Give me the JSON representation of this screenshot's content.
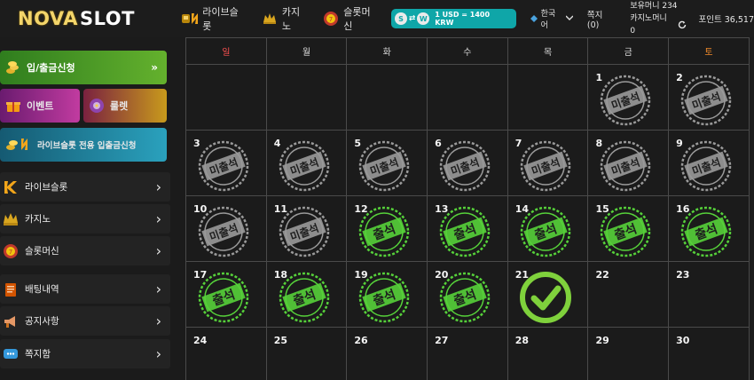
{
  "brand": {
    "logo_part1": "NOVA",
    "logo_part2": "SLOT"
  },
  "topnav": {
    "items": [
      {
        "label": "라이브슬롯",
        "icon": "live-slot-icon"
      },
      {
        "label": "카지노",
        "icon": "casino-icon"
      },
      {
        "label": "슬롯머신",
        "icon": "slot-machine-icon"
      }
    ],
    "rate_badge": {
      "coin1": "S",
      "coin2": "W",
      "text": "1 USD = 1400 KRW"
    },
    "language": "한국어",
    "message": "쪽지(0)",
    "holding_money": "보유머니 234",
    "casino_money": "카지노머니 0",
    "points": "포인트 36,517"
  },
  "sidebar": {
    "deposit": "입/출금신청",
    "event": "이벤트",
    "roulette": "룰렛",
    "live_deposit": "라이브슬롯 전용 입출금신청",
    "menu": [
      {
        "label": "라이브슬롯",
        "icon": "live-slot-icon"
      },
      {
        "label": "카지노",
        "icon": "casino-icon"
      },
      {
        "label": "슬롯머신",
        "icon": "slot-machine-icon"
      },
      {
        "label": "배팅내역",
        "icon": "betting-history-icon"
      },
      {
        "label": "공지사항",
        "icon": "megaphone-icon"
      },
      {
        "label": "쪽지함",
        "icon": "message-box-icon"
      }
    ]
  },
  "calendar": {
    "weekdays": [
      "일",
      "월",
      "화",
      "수",
      "목",
      "금",
      "토"
    ],
    "absent_label": "미출석",
    "present_label": "출석",
    "days": [
      {
        "day": "",
        "status": ""
      },
      {
        "day": "",
        "status": ""
      },
      {
        "day": "",
        "status": ""
      },
      {
        "day": "",
        "status": ""
      },
      {
        "day": "",
        "status": ""
      },
      {
        "day": "1",
        "status": "absent"
      },
      {
        "day": "2",
        "status": "absent"
      },
      {
        "day": "3",
        "status": "absent"
      },
      {
        "day": "4",
        "status": "absent"
      },
      {
        "day": "5",
        "status": "absent"
      },
      {
        "day": "6",
        "status": "absent"
      },
      {
        "day": "7",
        "status": "absent"
      },
      {
        "day": "8",
        "status": "absent"
      },
      {
        "day": "9",
        "status": "absent"
      },
      {
        "day": "10",
        "status": "absent"
      },
      {
        "day": "11",
        "status": "absent"
      },
      {
        "day": "12",
        "status": "present"
      },
      {
        "day": "13",
        "status": "present"
      },
      {
        "day": "14",
        "status": "present"
      },
      {
        "day": "15",
        "status": "present"
      },
      {
        "day": "16",
        "status": "present"
      },
      {
        "day": "17",
        "status": "present"
      },
      {
        "day": "18",
        "status": "present"
      },
      {
        "day": "19",
        "status": "present"
      },
      {
        "day": "20",
        "status": "present"
      },
      {
        "day": "21",
        "status": "today"
      },
      {
        "day": "22",
        "status": ""
      },
      {
        "day": "23",
        "status": ""
      },
      {
        "day": "24",
        "status": ""
      },
      {
        "day": "25",
        "status": ""
      },
      {
        "day": "26",
        "status": ""
      },
      {
        "day": "27",
        "status": ""
      },
      {
        "day": "28",
        "status": ""
      },
      {
        "day": "29",
        "status": ""
      },
      {
        "day": "30",
        "status": ""
      }
    ]
  },
  "colors": {
    "absent": "#9a9a9a",
    "present": "#56d13a",
    "check": "#7fd13c",
    "sunday": "#ff5151",
    "saturday": "#f08b2a"
  }
}
